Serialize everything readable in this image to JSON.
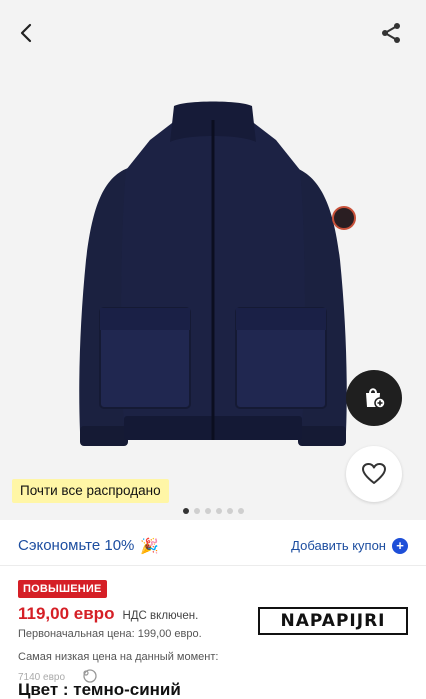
{
  "gallery": {
    "stock_badge": "Почти все распродано",
    "dots_total": 6,
    "active_dot": 0
  },
  "icons": {
    "back": "back-arrow-icon",
    "share": "share-icon",
    "cart": "shopping-bag-add-icon",
    "wishlist": "heart-icon"
  },
  "savings": {
    "text": "Сэкономьте 10%",
    "emoji": "🎉",
    "coupon_label": "Добавить купон"
  },
  "pricing": {
    "promo_tag": "ПОВЫШЕНИЕ",
    "price": "119,00 евро",
    "vat": "НДС включен.",
    "original": "Первоначальная цена: 199,00 евро.",
    "lowest": "Самая низкая цена на данный момент:",
    "lowest_value": "7140 евро"
  },
  "product": {
    "color_label": "Цвет : темно-синий",
    "brand": "NAPAPIJRI"
  },
  "colors": {
    "accent_red": "#d51f26",
    "link_blue": "#1d4ea0",
    "badge_yellow": "#fff6a6"
  }
}
